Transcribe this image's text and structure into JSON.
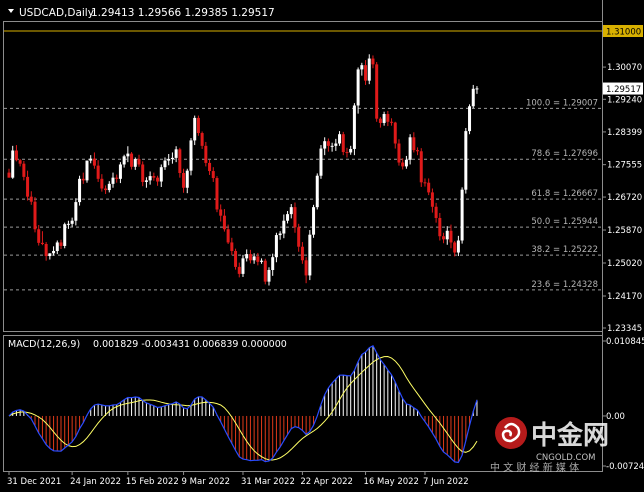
{
  "colors": {
    "background": "#000000",
    "frame": "#8c8c8c",
    "text": "#ffffff",
    "bull": "#ffffff",
    "bear": "#e01a1a",
    "macd_pos": "#ffffff",
    "macd_neg": "#e03a1a",
    "signal": "#ffff66",
    "macd_line": "#2a4cff",
    "level_line": "#d8b000",
    "fib_text": "#b4b4b4",
    "logo_red": "#d62020"
  },
  "header": {
    "title": "USDCAD,Daily",
    "ohlc": "1.29413 1.29566 1.29385 1.29517"
  },
  "chart_data": [
    {
      "type": "candlestick",
      "symbol": "USDCAD",
      "timeframe": "Daily",
      "current_price": "1.29517",
      "price_ticks": [
        "1.31000",
        "1.30070",
        "1.29240",
        "1.28399",
        "1.27555",
        "1.26720",
        "1.25870",
        "1.25020",
        "1.24170",
        "1.23345"
      ],
      "level_line": {
        "label": "1.31000",
        "value": 1.31
      },
      "fib_levels": [
        {
          "label": "100.0 = 1.29007",
          "value": 1.29007
        },
        {
          "label": "78.6 = 1.27696",
          "value": 1.27696
        },
        {
          "label": "61.8 = 1.26667",
          "value": 1.26667
        },
        {
          "label": "50.0 = 1.25944",
          "value": 1.25944
        },
        {
          "label": "38.2 = 1.25222",
          "value": 1.25222
        },
        {
          "label": "23.6 = 1.24328",
          "value": 1.24328
        }
      ],
      "x_ticks": [
        "31 Dec 2021",
        "24 Jan 2022",
        "15 Feb 2022",
        "9 Mar 2022",
        "31 Mar 2022",
        "22 Apr 2022",
        "16 May 2022",
        "7 Jun 2022"
      ],
      "ohlc": {
        "open": [
          1.2735,
          1.2722,
          1.2792,
          1.2767,
          1.2758,
          1.2724,
          1.2673,
          1.266,
          1.2589,
          1.2554,
          1.2551,
          1.252,
          1.2527,
          1.2533,
          1.2555,
          1.2546,
          1.2602,
          1.2603,
          1.2611,
          1.2659,
          1.2719,
          1.2715,
          1.2766,
          1.2771,
          1.2753,
          1.2719,
          1.2694,
          1.269,
          1.2706,
          1.2722,
          1.2719,
          1.2756,
          1.2777,
          1.2784,
          1.275,
          1.277,
          1.2756,
          1.2711,
          1.2715,
          1.2726,
          1.2722,
          1.2712,
          1.2749,
          1.2766,
          1.277,
          1.2773,
          1.2795,
          1.2734,
          1.2696,
          1.274,
          1.2818,
          1.2876,
          1.2837,
          1.2804,
          1.276,
          1.2739,
          1.2721,
          1.264,
          1.2624,
          1.2589,
          1.2555,
          1.2533,
          1.2492,
          1.2474,
          1.2514,
          1.2525,
          1.2509,
          1.2519,
          1.2505,
          1.2508,
          1.2454,
          1.2484,
          1.2517,
          1.2574,
          1.2578,
          1.2611,
          1.2628,
          1.2646,
          1.2594,
          1.2544,
          1.2509,
          1.247,
          1.2575,
          1.2646,
          1.2727,
          1.2797,
          1.2816,
          1.2804,
          1.2804,
          1.281,
          1.2834,
          1.2788,
          1.2787,
          1.2796,
          1.2908,
          1.3001,
          1.3012,
          1.2972,
          1.3029,
          1.3014,
          1.2874,
          1.2863,
          1.2886,
          1.2866,
          1.2864,
          1.281,
          1.2761,
          1.2751,
          1.2768,
          1.2826,
          1.2793,
          1.279,
          1.271,
          1.2709,
          1.2684,
          1.2647,
          1.2618,
          1.2571,
          1.2563,
          1.2585,
          1.2555,
          1.2529,
          1.256,
          1.2691,
          1.2842,
          1.2906,
          1.2951
        ],
        "high": [
          1.2745,
          1.2804,
          1.2806,
          1.277,
          1.2765,
          1.274,
          1.2687,
          1.2672,
          1.26,
          1.2584,
          1.2556,
          1.2527,
          1.2545,
          1.256,
          1.2562,
          1.2606,
          1.2611,
          1.2619,
          1.2669,
          1.2727,
          1.2735,
          1.2766,
          1.278,
          1.2787,
          1.2767,
          1.2731,
          1.2702,
          1.2713,
          1.2735,
          1.273,
          1.2762,
          1.2781,
          1.2803,
          1.2788,
          1.2774,
          1.2781,
          1.2764,
          1.2723,
          1.2738,
          1.2735,
          1.2727,
          1.2756,
          1.2774,
          1.2783,
          1.2787,
          1.2803,
          1.2799,
          1.2745,
          1.2745,
          1.2824,
          1.2882,
          1.2882,
          1.2841,
          1.2814,
          1.2768,
          1.2749,
          1.2726,
          1.2653,
          1.2641,
          1.2601,
          1.2567,
          1.2539,
          1.2503,
          1.2523,
          1.2537,
          1.2536,
          1.2527,
          1.2528,
          1.2514,
          1.2513,
          1.2491,
          1.2526,
          1.258,
          1.2584,
          1.2627,
          1.2636,
          1.2654,
          1.2658,
          1.2603,
          1.2556,
          1.2517,
          1.2587,
          1.2652,
          1.2733,
          1.2806,
          1.2826,
          1.2823,
          1.2812,
          1.2822,
          1.2842,
          1.284,
          1.2799,
          1.2804,
          1.2914,
          1.3006,
          1.3018,
          1.3025,
          1.304,
          1.3037,
          1.302,
          1.2878,
          1.2892,
          1.2894,
          1.2875,
          1.2866,
          1.2821,
          1.2772,
          1.2778,
          1.2834,
          1.2839,
          1.28,
          1.2798,
          1.272,
          1.272,
          1.2694,
          1.2657,
          1.2631,
          1.258,
          1.2597,
          1.2601,
          1.2559,
          1.2572,
          1.2697,
          1.285,
          1.2911,
          1.2961,
          1.2958
        ],
        "low": [
          1.2722,
          1.2719,
          1.2764,
          1.2751,
          1.2715,
          1.2663,
          1.2652,
          1.2581,
          1.2547,
          1.2548,
          1.2508,
          1.2511,
          1.2521,
          1.2525,
          1.2538,
          1.254,
          1.259,
          1.2595,
          1.2599,
          1.265,
          1.2706,
          1.2709,
          1.2759,
          1.2745,
          1.2711,
          1.2686,
          1.268,
          1.2684,
          1.2696,
          1.2709,
          1.2708,
          1.2748,
          1.2762,
          1.2743,
          1.2742,
          1.275,
          1.27,
          1.2696,
          1.2704,
          1.2714,
          1.2701,
          1.2698,
          1.2742,
          1.2754,
          1.2758,
          1.2762,
          1.2722,
          1.2683,
          1.2682,
          1.2728,
          1.2806,
          1.283,
          1.2796,
          1.2751,
          1.2729,
          1.2711,
          1.2633,
          1.2609,
          1.2583,
          1.2551,
          1.2522,
          1.2485,
          1.2465,
          1.2466,
          1.2506,
          1.2501,
          1.25,
          1.2496,
          1.25,
          1.2447,
          1.2444,
          1.2469,
          1.2504,
          1.2562,
          1.2566,
          1.2604,
          1.2617,
          1.258,
          1.2531,
          1.25,
          1.245,
          1.2458,
          1.2567,
          1.264,
          1.2719,
          1.278,
          1.2789,
          1.2789,
          1.2791,
          1.2804,
          1.278,
          1.2774,
          1.2781,
          1.278,
          1.2887,
          1.2985,
          1.2961,
          1.2963,
          1.3004,
          1.2866,
          1.2851,
          1.2856,
          1.2855,
          1.2856,
          1.2797,
          1.2753,
          1.2743,
          1.2745,
          1.2756,
          1.2787,
          1.278,
          1.2698,
          1.2699,
          1.2677,
          1.2632,
          1.2606,
          1.256,
          1.2553,
          1.2549,
          1.254,
          1.2519,
          1.252,
          1.2552,
          1.2681,
          1.2834,
          1.2901,
          1.2938
        ],
        "close": [
          1.2722,
          1.2792,
          1.2767,
          1.2758,
          1.2724,
          1.2673,
          1.266,
          1.2589,
          1.2554,
          1.2551,
          1.252,
          1.2527,
          1.2533,
          1.2555,
          1.2546,
          1.2602,
          1.2603,
          1.2611,
          1.2659,
          1.2719,
          1.2715,
          1.2766,
          1.2771,
          1.2753,
          1.2719,
          1.2694,
          1.269,
          1.2706,
          1.2722,
          1.2719,
          1.2756,
          1.2777,
          1.2784,
          1.275,
          1.277,
          1.2756,
          1.2711,
          1.2715,
          1.2726,
          1.2722,
          1.2712,
          1.2749,
          1.2766,
          1.277,
          1.2773,
          1.2795,
          1.2734,
          1.2696,
          1.274,
          1.2818,
          1.2876,
          1.2837,
          1.2804,
          1.276,
          1.2739,
          1.2721,
          1.264,
          1.2624,
          1.2589,
          1.2555,
          1.2533,
          1.2492,
          1.2474,
          1.2514,
          1.2525,
          1.2509,
          1.2519,
          1.2505,
          1.2508,
          1.2454,
          1.2484,
          1.2517,
          1.2574,
          1.2578,
          1.2611,
          1.2628,
          1.2646,
          1.2594,
          1.2544,
          1.2509,
          1.247,
          1.2575,
          1.2646,
          1.2727,
          1.2797,
          1.2816,
          1.2804,
          1.2804,
          1.281,
          1.2834,
          1.2788,
          1.2787,
          1.2796,
          1.2908,
          1.3001,
          1.3012,
          1.2972,
          1.3029,
          1.3014,
          1.2874,
          1.2863,
          1.2886,
          1.2866,
          1.2864,
          1.281,
          1.2761,
          1.2751,
          1.2768,
          1.2826,
          1.2793,
          1.279,
          1.271,
          1.2709,
          1.2684,
          1.2647,
          1.2618,
          1.2571,
          1.2563,
          1.2585,
          1.2555,
          1.2529,
          1.256,
          1.2691,
          1.2842,
          1.2906,
          1.2951,
          1.2952
        ]
      }
    },
    {
      "type": "histogram+line",
      "indicator": "MACD(12,26,9)",
      "values_label": "0.001829 -0.003431 0.006839 0.000000",
      "y_ticks": [
        "0.010845",
        "0.00",
        "-0.00724"
      ],
      "ylim": [
        -0.00724,
        0.010845
      ]
    }
  ],
  "watermark": {
    "brand": "中金网",
    "url": "CNGOLD.COM",
    "slogan": "中 文 财 经 新 媒 体"
  }
}
